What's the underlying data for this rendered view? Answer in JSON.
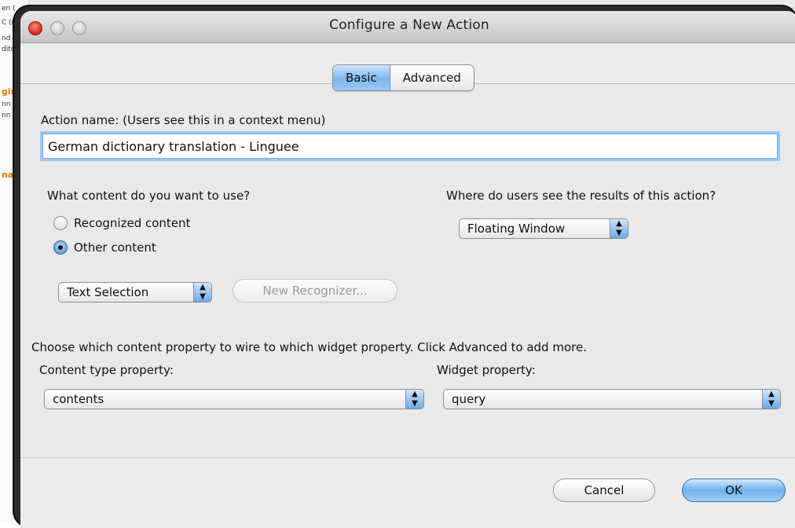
{
  "window": {
    "title": "Configure a New Action"
  },
  "tabs": [
    {
      "label": "Basic",
      "active": true
    },
    {
      "label": "Advanced",
      "active": false
    }
  ],
  "action_name": {
    "label": "Action name: (Users see this in a context menu)",
    "value": "German dictionary translation - Linguee"
  },
  "content_section": {
    "question": "What content do you want to use?",
    "options": [
      {
        "label": "Recognized content",
        "selected": false
      },
      {
        "label": "Other content",
        "selected": true
      }
    ],
    "selection_popup": "Text Selection",
    "new_recognizer_label": "New Recognizer..."
  },
  "results_section": {
    "question": "Where do users see the results of this action?",
    "popup_value": "Floating Window"
  },
  "wiring": {
    "instruction": "Choose which content property to wire to which widget property. Click Advanced to add more.",
    "content_type_label": "Content type property:",
    "content_type_value": "contents",
    "widget_label": "Widget property:",
    "widget_value": "query"
  },
  "buttons": {
    "cancel": "Cancel",
    "ok": "OK"
  },
  "background": {
    "fragments": [
      "en (",
      "C (n",
      "nd",
      "dito",
      "gin",
      "nn",
      "nn",
      "na"
    ]
  },
  "colors": {
    "accent": "#7db6ec",
    "focus_ring": "#9cc6f2",
    "close_red": "#d9271c"
  }
}
